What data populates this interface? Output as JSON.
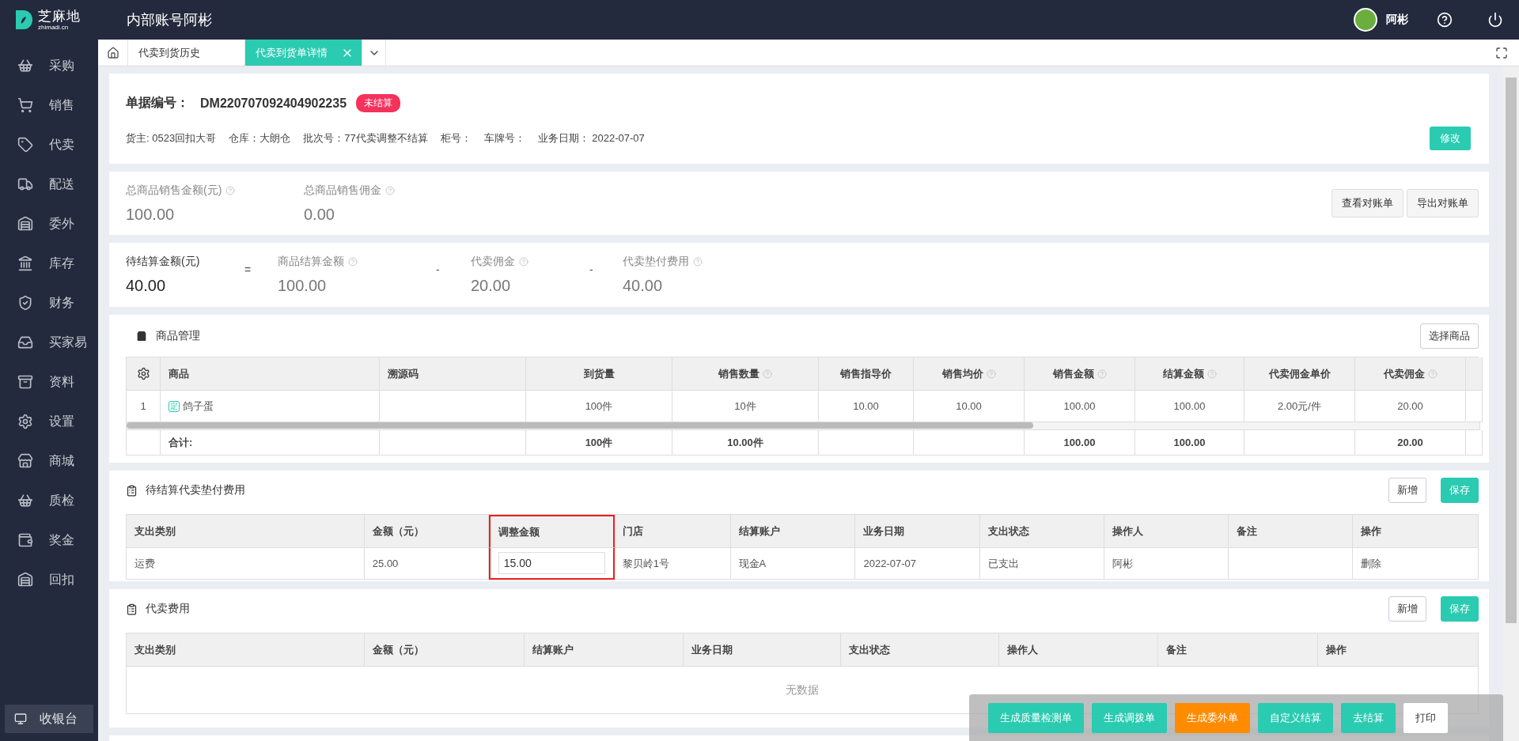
{
  "app": {
    "logo_text": "芝麻地",
    "logo_sub": "zhimadi.cn",
    "account": "内部账号阿彬"
  },
  "user": {
    "name": "阿彬"
  },
  "sidebar": {
    "items": [
      {
        "label": "采购"
      },
      {
        "label": "销售"
      },
      {
        "label": "代卖"
      },
      {
        "label": "配送"
      },
      {
        "label": "委外"
      },
      {
        "label": "库存"
      },
      {
        "label": "财务"
      },
      {
        "label": "买家易"
      },
      {
        "label": "资料"
      },
      {
        "label": "设置"
      },
      {
        "label": "商城"
      },
      {
        "label": "质检"
      },
      {
        "label": "奖金"
      },
      {
        "label": "回扣"
      }
    ],
    "cashier": "收银台"
  },
  "tabs": [
    {
      "label": "代卖到货历史",
      "selected": false,
      "closable": false
    },
    {
      "label": "代卖到货单详情",
      "selected": true,
      "closable": true
    }
  ],
  "order": {
    "label": "单据编号：",
    "number": "DM220707092404902235",
    "status": "未结算",
    "fields": [
      "货主: 0523回扣大哥",
      "仓库：大朗仓",
      "批次号：77代卖调整不结算",
      "柜号：",
      "车牌号：",
      "业务日期： 2022-07-07"
    ],
    "edit_button": "修改"
  },
  "sales_summary": {
    "metrics": [
      {
        "label": "总商品销售金额(元)",
        "value": "100.00",
        "help": true
      },
      {
        "label": "总商品销售佣金",
        "value": "0.00",
        "help": true
      }
    ],
    "buttons": [
      "查看对账单",
      "导出对账单"
    ]
  },
  "settlement": {
    "items": [
      {
        "kind": "metric",
        "label": "待结算金额(元)",
        "value": "40.00",
        "help": false,
        "emphasis": true
      },
      {
        "kind": "operator",
        "symbol": "="
      },
      {
        "kind": "metric",
        "label": "商品结算金额",
        "value": "100.00",
        "help": true,
        "emphasis": false
      },
      {
        "kind": "operator",
        "symbol": "-"
      },
      {
        "kind": "metric",
        "label": "代卖佣金",
        "value": "20.00",
        "help": true,
        "emphasis": false
      },
      {
        "kind": "operator",
        "symbol": "-"
      },
      {
        "kind": "metric",
        "label": "代卖垫付费用",
        "value": "40.00",
        "help": true,
        "emphasis": false
      }
    ]
  },
  "products": {
    "title": "商品管理",
    "button": "选择商品",
    "columns": [
      {
        "label": "商品",
        "help": false
      },
      {
        "label": "溯源码",
        "help": false
      },
      {
        "label": "到货量",
        "help": false
      },
      {
        "label": "销售数量",
        "help": true
      },
      {
        "label": "销售指导价",
        "help": false
      },
      {
        "label": "销售均价",
        "help": true
      },
      {
        "label": "销售金额",
        "help": true
      },
      {
        "label": "结算金额",
        "help": true
      },
      {
        "label": "代卖佣金单价",
        "help": false
      },
      {
        "label": "代卖佣金",
        "help": true
      }
    ],
    "rows": [
      {
        "index": "1",
        "tag": "定",
        "cells": [
          "鸽子蛋",
          "",
          "100件",
          "10件",
          "10.00",
          "10.00",
          "100.00",
          "100.00",
          "2.00元/件",
          "20.00"
        ]
      }
    ],
    "totals": {
      "cells": [
        "合计:",
        "",
        "100件",
        "10.00件",
        "",
        "",
        "100.00",
        "100.00",
        "",
        "20.00"
      ]
    }
  },
  "advance_fees": {
    "title": "待结算代卖垫付费用",
    "buttons": [
      {
        "label": "新增",
        "kind": "default"
      },
      {
        "label": "保存",
        "kind": "primary"
      }
    ],
    "columns": [
      {
        "label": "支出类别",
        "highlighted": false
      },
      {
        "label": "金额（元）",
        "highlighted": false
      },
      {
        "label": "调整金额",
        "highlighted": true
      },
      {
        "label": "门店",
        "highlighted": false
      },
      {
        "label": "结算账户",
        "highlighted": false
      },
      {
        "label": "业务日期",
        "highlighted": false
      },
      {
        "label": "支出状态",
        "highlighted": false
      },
      {
        "label": "操作人",
        "highlighted": false
      },
      {
        "label": "备注",
        "highlighted": false
      },
      {
        "label": "操作",
        "highlighted": false
      }
    ],
    "rows": [
      {
        "cells": [
          {
            "kind": "text",
            "value": "运费"
          },
          {
            "kind": "text",
            "value": "25.00"
          },
          {
            "kind": "input",
            "value": "15.00"
          },
          {
            "kind": "text",
            "value": "黎贝岭1号"
          },
          {
            "kind": "text",
            "value": "现金A"
          },
          {
            "kind": "text",
            "value": "2022-07-07"
          },
          {
            "kind": "text",
            "value": "已支出"
          },
          {
            "kind": "text",
            "value": "阿彬"
          },
          {
            "kind": "text"
          },
          {
            "kind": "link",
            "value": "删除"
          }
        ]
      }
    ]
  },
  "consign_fees": {
    "title": "代卖费用",
    "buttons": [
      {
        "label": "新增",
        "kind": "default"
      },
      {
        "label": "保存",
        "kind": "primary"
      }
    ],
    "columns": [
      {
        "label": "支出类别"
      },
      {
        "label": "金额（元）"
      },
      {
        "label": "结算账户"
      },
      {
        "label": "业务日期"
      },
      {
        "label": "支出状态"
      },
      {
        "label": "操作人"
      },
      {
        "label": "备注"
      },
      {
        "label": "操作"
      }
    ],
    "empty_text": "无数据"
  },
  "actions": [
    {
      "label": "生成质量检测单",
      "kind": "primary"
    },
    {
      "label": "生成调拨单",
      "kind": "primary"
    },
    {
      "label": "生成委外单",
      "kind": "warning"
    },
    {
      "label": "自定义结算",
      "kind": "primary"
    },
    {
      "label": "去结算",
      "kind": "primary"
    },
    {
      "label": "打印",
      "kind": "default"
    }
  ]
}
